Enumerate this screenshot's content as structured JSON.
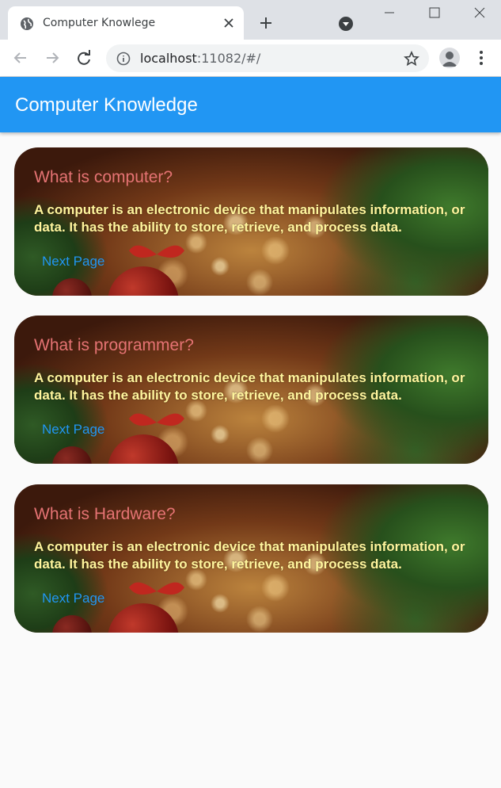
{
  "browser": {
    "tab_title": "Computer Knowlege",
    "url_host": "localhost",
    "url_rest": ":11082/#/"
  },
  "app": {
    "title": "Computer Knowledge"
  },
  "cards": [
    {
      "title": "What is computer?",
      "body": "A computer is an electronic device that manipulates information, or data. It has the ability to store, retrieve, and process data.",
      "link": "Next Page"
    },
    {
      "title": "What is programmer?",
      "body": "A computer is an electronic device that manipulates information, or data. It has the ability to store, retrieve, and process data.",
      "link": "Next Page"
    },
    {
      "title": "What is Hardware?",
      "body": "A computer is an electronic device that manipulates information, or data. It has the ability to store, retrieve, and process data.",
      "link": "Next Page"
    }
  ],
  "colors": {
    "appbar": "#2196f3",
    "card_title": "#e57373",
    "card_body": "#fff59d",
    "link": "#2196f3"
  }
}
